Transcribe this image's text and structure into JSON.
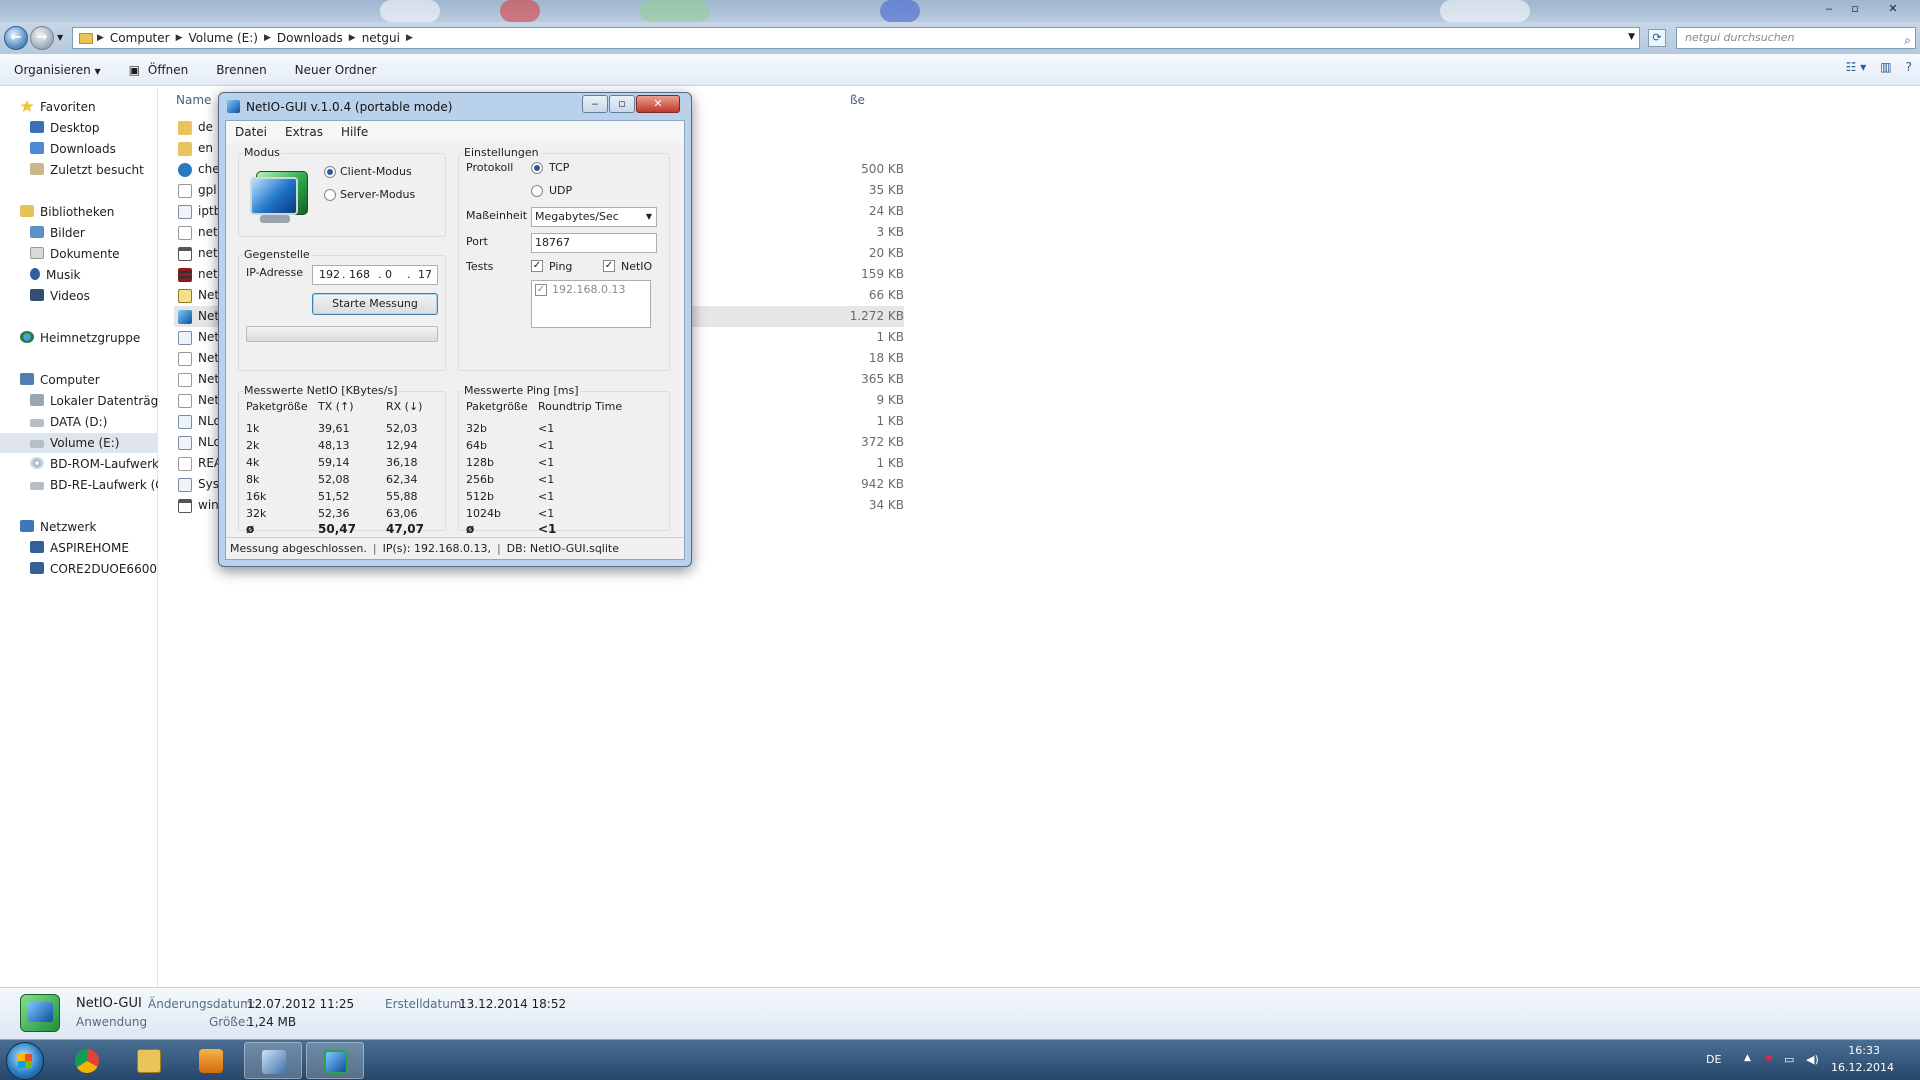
{
  "explorer": {
    "window_controls": {
      "minimize": "‒",
      "maximize": "▫",
      "close": "✕"
    },
    "address": {
      "segments": [
        "Computer",
        "Volume (E:)",
        "Downloads",
        "netgui"
      ]
    },
    "search_placeholder": "netgui durchsuchen",
    "toolbar": {
      "organize": "Organisieren",
      "open": "Öffnen",
      "burn": "Brennen",
      "new_folder": "Neuer Ordner"
    },
    "nav": {
      "favorites": "Favoriten",
      "fav_items": [
        "Desktop",
        "Downloads",
        "Zuletzt besucht"
      ],
      "libraries": "Bibliotheken",
      "lib_items": [
        "Bilder",
        "Dokumente",
        "Musik",
        "Videos"
      ],
      "homegroup": "Heimnetzgruppe",
      "computer": "Computer",
      "computer_items": [
        "Lokaler Datenträger",
        "DATA (D:)",
        "Volume (E:)",
        "BD-ROM-Laufwerk (",
        "BD-RE-Laufwerk (G:)"
      ],
      "network": "Netzwerk",
      "network_items": [
        "ASPIREHOME",
        "CORE2DUOE6600"
      ]
    },
    "columns": {
      "name": "Name",
      "size": "ße"
    },
    "files": [
      {
        "name": "de",
        "size": ""
      },
      {
        "name": "en",
        "size": ""
      },
      {
        "name": "che",
        "size": "500 KB"
      },
      {
        "name": "gpl",
        "size": "35 KB"
      },
      {
        "name": "iptb",
        "size": "24 KB"
      },
      {
        "name": "neti",
        "size": "3 KB"
      },
      {
        "name": "neti",
        "size": "20 KB"
      },
      {
        "name": "neti",
        "size": "159 KB"
      },
      {
        "name": "Net",
        "size": "66 KB"
      },
      {
        "name": "Net",
        "size": "1.272 KB"
      },
      {
        "name": "Net",
        "size": "1 KB"
      },
      {
        "name": "Net",
        "size": "18 KB"
      },
      {
        "name": "Net",
        "size": "365 KB"
      },
      {
        "name": "Net",
        "size": "9 KB"
      },
      {
        "name": "NLo",
        "size": "1 KB"
      },
      {
        "name": "NLo",
        "size": "372 KB"
      },
      {
        "name": "REA",
        "size": "1 KB"
      },
      {
        "name": "Syst",
        "size": "942 KB"
      },
      {
        "name": "win",
        "size": "34 KB"
      }
    ],
    "details": {
      "name": "NetIO-GUI",
      "type": "Anwendung",
      "modified_label": "Änderungsdatum:",
      "modified": "12.07.2012 11:25",
      "created_label": "Erstelldatum:",
      "created": "13.12.2014 18:52",
      "size_label": "Größe:",
      "size": "1,24 MB"
    }
  },
  "dialog": {
    "title": "NetIO-GUI v.1.0.4 (portable mode)",
    "menu": [
      "Datei",
      "Extras",
      "Hilfe"
    ],
    "modus": {
      "title": "Modus",
      "client": "Client-Modus",
      "server": "Server-Modus"
    },
    "gegenstelle": {
      "title": "Gegenstelle",
      "ip_label": "IP-Adresse",
      "ip": [
        "192",
        "168",
        "0",
        "17"
      ],
      "start_button": "Starte Messung"
    },
    "einstellungen": {
      "title": "Einstellungen",
      "protocol_label": "Protokoll",
      "tcp": "TCP",
      "udp": "UDP",
      "unit_label": "Maßeinheit",
      "unit_value": "Megabytes/Sec",
      "port_label": "Port",
      "port_value": "18767",
      "tests_label": "Tests",
      "ping": "Ping",
      "netio": "NetIO",
      "host": "192.168.0.13"
    },
    "netio_results": {
      "title": "Messwerte NetIO [KBytes/s]",
      "headers": [
        "Paketgröße",
        "TX (↑)",
        "RX (↓)"
      ],
      "rows": [
        [
          "1k",
          "39,61",
          "52,03"
        ],
        [
          "2k",
          "48,13",
          "12,94"
        ],
        [
          "4k",
          "59,14",
          "36,18"
        ],
        [
          "8k",
          "52,08",
          "62,34"
        ],
        [
          "16k",
          "51,52",
          "55,88"
        ],
        [
          "32k",
          "52,36",
          "63,06"
        ]
      ],
      "avg": [
        "ø",
        "50,47",
        "47,07"
      ]
    },
    "ping_results": {
      "title": "Messwerte Ping [ms]",
      "headers": [
        "Paketgröße",
        "Roundtrip Time"
      ],
      "rows": [
        [
          "32b",
          "<1"
        ],
        [
          "64b",
          "<1"
        ],
        [
          "128b",
          "<1"
        ],
        [
          "256b",
          "<1"
        ],
        [
          "512b",
          "<1"
        ],
        [
          "1024b",
          "<1"
        ]
      ],
      "avg": [
        "ø",
        "<1"
      ]
    },
    "status": {
      "message": "Messung abgeschlossen.",
      "ips": "IP(s): 192.168.0.13,",
      "db": "DB: NetIO-GUI.sqlite"
    }
  },
  "taskbar": {
    "language": "DE",
    "time": "16:33",
    "date": "16.12.2014"
  }
}
